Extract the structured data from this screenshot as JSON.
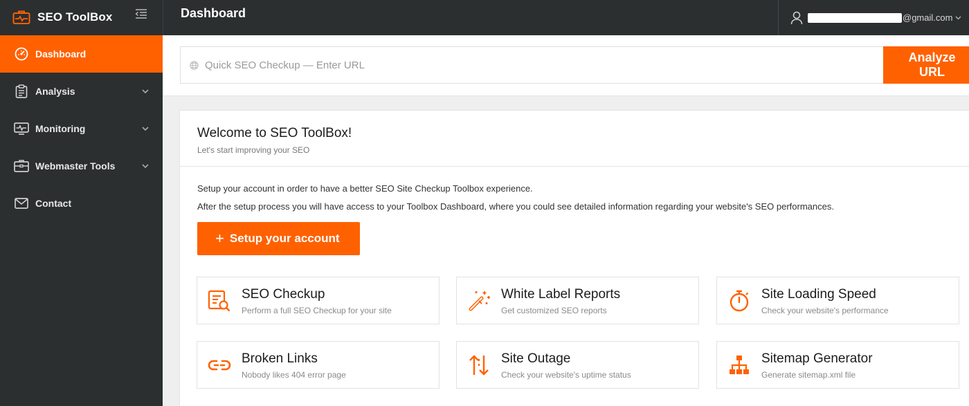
{
  "brand": {
    "name": "SEO ToolBox"
  },
  "sidebar": {
    "items": [
      {
        "label": "Dashboard",
        "icon": "speedometer-icon",
        "active": true
      },
      {
        "label": "Analysis",
        "icon": "clipboard-icon",
        "has_children": true
      },
      {
        "label": "Monitoring",
        "icon": "monitor-pulse-icon",
        "has_children": true
      },
      {
        "label": "Webmaster Tools",
        "icon": "toolbox-icon",
        "has_children": true
      },
      {
        "label": "Contact",
        "icon": "envelope-icon"
      }
    ]
  },
  "header": {
    "title": "Dashboard",
    "user_email_suffix": "@gmail.com"
  },
  "search": {
    "placeholder": "Quick SEO Checkup — Enter URL",
    "button_label": "Analyze URL"
  },
  "welcome": {
    "title": "Welcome to SEO ToolBox!",
    "subtitle": "Let's start improving your SEO",
    "line1": "Setup your account in order to have a better SEO Site Checkup Toolbox experience.",
    "line2": "After the setup process you will have access to your Toolbox Dashboard, where you could see detailed information regarding your website's SEO performances.",
    "setup_button": "Setup your account"
  },
  "tools": [
    {
      "name": "SEO Checkup",
      "desc": "Perform a full SEO Checkup for your site",
      "icon": "seo-checkup-icon"
    },
    {
      "name": "White Label Reports",
      "desc": "Get customized SEO reports",
      "icon": "magic-wand-icon"
    },
    {
      "name": "Site Loading Speed",
      "desc": "Check your website's performance",
      "icon": "stopwatch-icon"
    },
    {
      "name": "Broken Links",
      "desc": "Nobody likes 404 error page",
      "icon": "broken-link-icon"
    },
    {
      "name": "Site Outage",
      "desc": "Check your website's uptime status",
      "icon": "up-down-arrows-icon"
    },
    {
      "name": "Sitemap Generator",
      "desc": "Generate sitemap.xml file",
      "icon": "sitemap-icon"
    }
  ],
  "colors": {
    "accent": "#ff6100",
    "sidebar_bg": "#2b2f30"
  }
}
